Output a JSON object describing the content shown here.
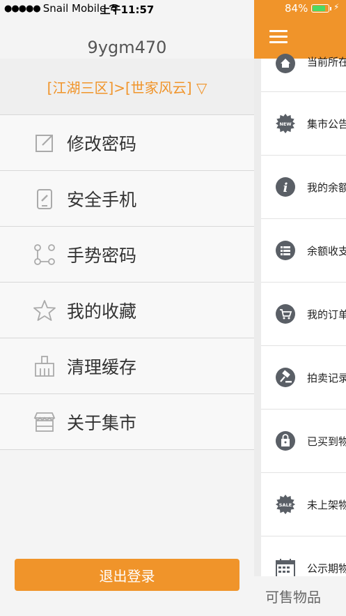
{
  "status_bar": {
    "carrier": "Snail Mobile",
    "time": "上午11:57",
    "battery": "84%"
  },
  "drawer": {
    "username": "9ygm470",
    "server": "[江湖三区]>[世家风云] ▽",
    "menu": [
      {
        "label": "修改密码",
        "icon": "edit-icon"
      },
      {
        "label": "安全手机",
        "icon": "phone-link-icon"
      },
      {
        "label": "手势密码",
        "icon": "gesture-icon"
      },
      {
        "label": "我的收藏",
        "icon": "star-icon"
      },
      {
        "label": "清理缓存",
        "icon": "broom-icon"
      },
      {
        "label": "关于集市",
        "icon": "store-icon"
      }
    ],
    "logout": "退出登录"
  },
  "content": {
    "rows": [
      {
        "label": "当前所在",
        "icon": "home-icon"
      },
      {
        "label": "集市公告",
        "icon": "new-badge-icon"
      },
      {
        "label": "我的余额",
        "icon": "info-icon"
      },
      {
        "label": "余额收支",
        "icon": "list-icon"
      },
      {
        "label": "我的订单",
        "icon": "cart-icon"
      },
      {
        "label": "拍卖记录",
        "icon": "gavel-icon"
      },
      {
        "label": "已买到物品",
        "icon": "lock-bag-icon"
      },
      {
        "label": "未上架物品",
        "icon": "sale-badge-icon"
      },
      {
        "label": "公示期物品",
        "icon": "calendar-icon"
      }
    ],
    "bottom_tab": "可售物品"
  },
  "colors": {
    "accent": "#f0942a",
    "icon_gray": "#5a5f66",
    "drawer_bg": "#f4f4f4"
  }
}
